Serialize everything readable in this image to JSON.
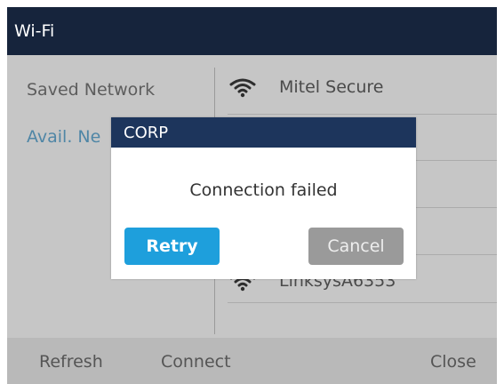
{
  "window": {
    "title": "Wi-Fi"
  },
  "left_menu": {
    "items": [
      {
        "label": "Saved Network"
      },
      {
        "label": "Avail. Ne"
      }
    ]
  },
  "networks": [
    {
      "name": "Mitel Secure"
    },
    {
      "name": "LinksysA6353"
    }
  ],
  "softkeys": {
    "refresh": "Refresh",
    "connect": "Connect",
    "close": "Close"
  },
  "dialog": {
    "title": "CORP",
    "message": "Connection failed",
    "retry": "Retry",
    "cancel": "Cancel"
  },
  "colors": {
    "titlebar": "#16243c",
    "dialog_title": "#1d355c",
    "retry_button": "#1e9fdc",
    "cancel_button": "#9a9a9a",
    "selected_text": "#4f86a6"
  },
  "icons": {
    "network": "wifi-icon"
  }
}
